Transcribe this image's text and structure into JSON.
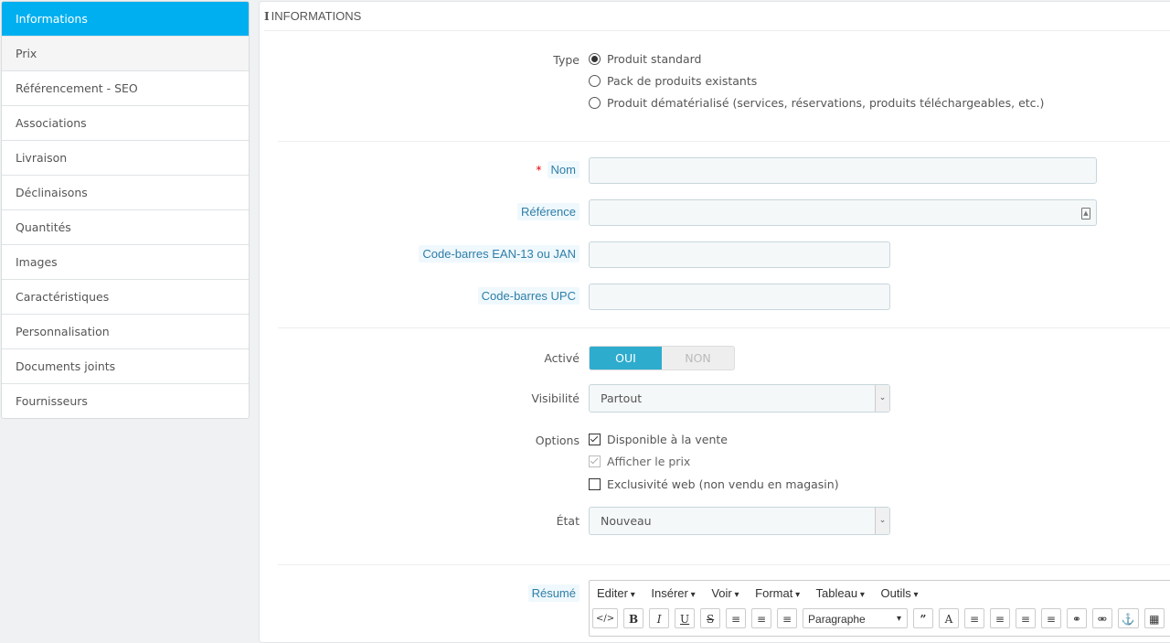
{
  "sidebar": {
    "items": [
      {
        "label": "Informations",
        "active": true
      },
      {
        "label": "Prix"
      },
      {
        "label": "Référencement - SEO"
      },
      {
        "label": "Associations"
      },
      {
        "label": "Livraison"
      },
      {
        "label": "Déclinaisons"
      },
      {
        "label": "Quantités"
      },
      {
        "label": "Images"
      },
      {
        "label": "Caractéristiques"
      },
      {
        "label": "Personnalisation"
      },
      {
        "label": "Documents joints"
      },
      {
        "label": "Fournisseurs"
      }
    ]
  },
  "panel": {
    "title_icon": "info-icon",
    "title": "Informations"
  },
  "form": {
    "type": {
      "label": "Type",
      "options": [
        "Produit standard",
        "Pack de produits existants",
        "Produit dématérialisé (services, réservations, produits téléchargeables, etc.)"
      ],
      "selected": "Produit standard"
    },
    "nom": {
      "label": "Nom",
      "required_mark": "*",
      "value": ""
    },
    "reference": {
      "label": "Référence",
      "value": ""
    },
    "ean13": {
      "label": "Code-barres EAN-13 ou JAN",
      "value": ""
    },
    "upc": {
      "label": "Code-barres UPC",
      "value": ""
    },
    "active": {
      "label": "Activé",
      "on_label": "OUI",
      "off_label": "NON",
      "value": "OUI"
    },
    "visibility": {
      "label": "Visibilité",
      "value": "Partout"
    },
    "options": {
      "label": "Options",
      "items": [
        {
          "label": "Disponible à la vente",
          "checked": true,
          "disabled": false
        },
        {
          "label": "Afficher le prix",
          "checked": true,
          "disabled": true
        },
        {
          "label": "Exclusivité web (non vendu en magasin)",
          "checked": false,
          "disabled": false
        }
      ]
    },
    "condition": {
      "label": "État",
      "value": "Nouveau"
    },
    "summary": {
      "label": "Résumé",
      "menu": [
        "Editer",
        "Insérer",
        "Voir",
        "Format",
        "Tableau",
        "Outils"
      ],
      "format_select": "Paragraphe"
    }
  },
  "colors": {
    "accent": "#00aff0",
    "switch_on": "#2eacce",
    "hint_text": "#2e7ea7"
  }
}
